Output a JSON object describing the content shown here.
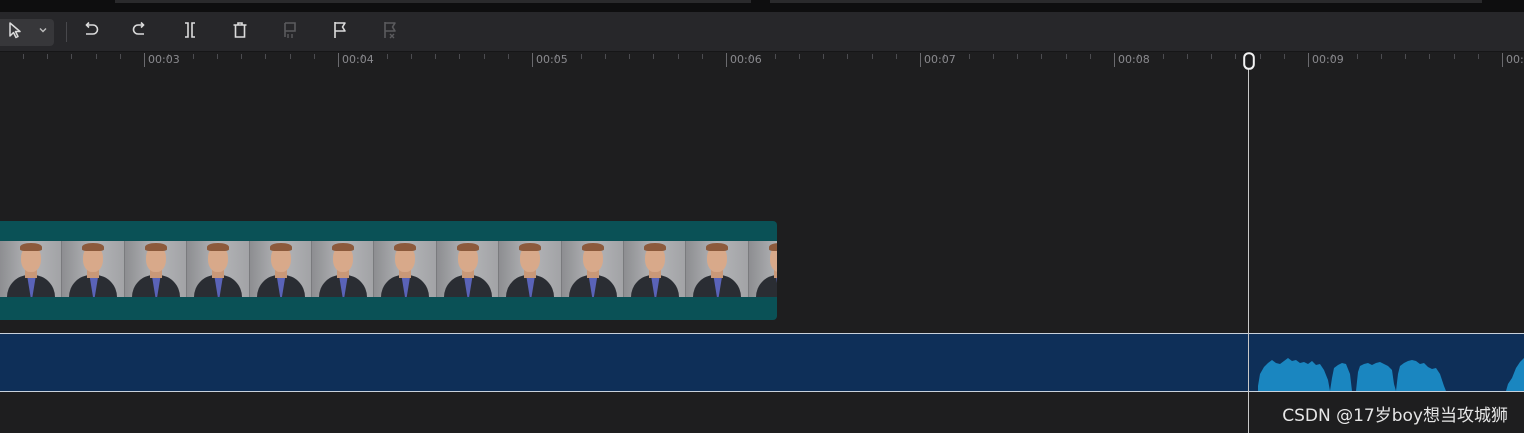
{
  "toolbar": {
    "tools": [
      {
        "name": "select-tool",
        "icon": "cursor-arrow-icon",
        "enabled": true
      },
      {
        "name": "undo",
        "icon": "undo-icon",
        "enabled": true
      },
      {
        "name": "redo",
        "icon": "redo-icon",
        "enabled": true
      },
      {
        "name": "split",
        "icon": "split-icon",
        "enabled": true
      },
      {
        "name": "delete",
        "icon": "trash-icon",
        "enabled": true
      },
      {
        "name": "freeze-frame",
        "icon": "freeze-frame-icon",
        "enabled": false
      },
      {
        "name": "add-marker",
        "icon": "flag-icon",
        "enabled": true
      },
      {
        "name": "remove-marker",
        "icon": "flag-remove-icon",
        "enabled": false
      }
    ]
  },
  "ruler": {
    "labels": [
      "00:03",
      "00:04",
      "00:05",
      "00:06",
      "00:07",
      "00:08",
      "00:09",
      "00:"
    ]
  },
  "timeline": {
    "playhead_time": "between 00:08 and 00:09",
    "video_clip": {
      "frame_count": 13
    },
    "audio_clip": {
      "waveform_starts_near": "playhead"
    }
  },
  "colors": {
    "background": "#1e1e1f",
    "toolbar": "#27272a",
    "video_clip": "#0a5156",
    "audio_track": "#0e2f58",
    "waveform": "#1a86c0",
    "playhead": "#c8c8c8"
  },
  "watermark": {
    "text": "CSDN @17岁boy想当攻城狮"
  }
}
